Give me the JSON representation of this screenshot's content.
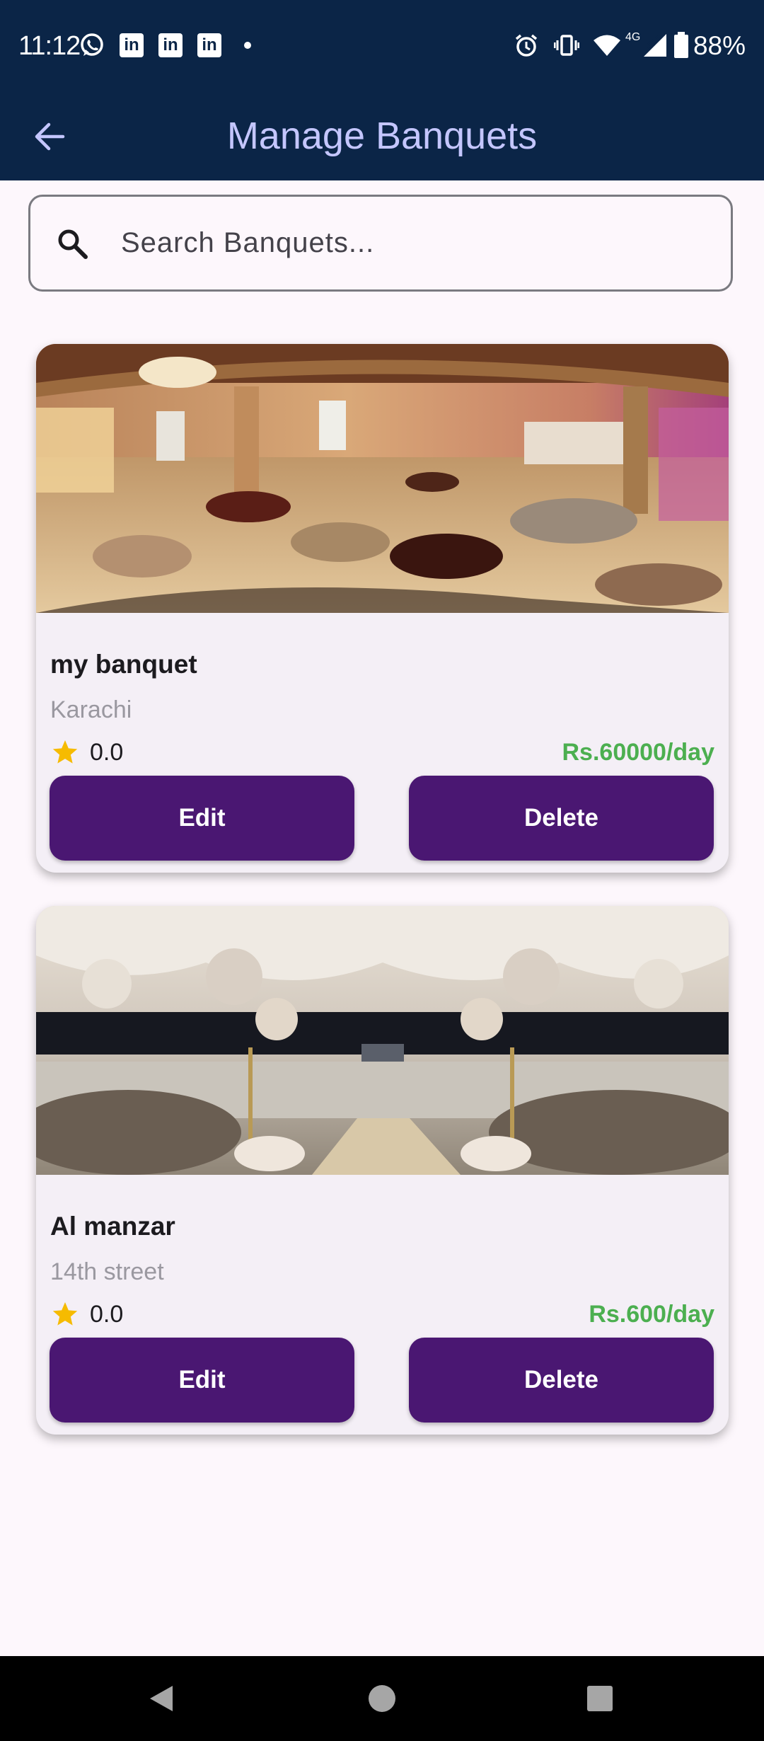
{
  "status_bar": {
    "time": "11:12",
    "battery": "88%",
    "network_label": "4G",
    "icons": [
      "whatsapp-icon",
      "linkedin-icon",
      "linkedin-icon",
      "linkedin-icon",
      "alarm-icon",
      "vibrate-icon",
      "wifi-icon",
      "signal-icon",
      "battery-icon"
    ],
    "linkedin_letters": "in"
  },
  "app_bar": {
    "title": "Manage Banquets",
    "back_icon": "arrow-left-icon",
    "title_color": "#c4c6ff",
    "background": "#0b2547"
  },
  "search": {
    "placeholder": "Search Banquets...",
    "value": "",
    "icon": "search-icon"
  },
  "banquets": [
    {
      "name": "my banquet",
      "location": "Karachi",
      "rating": "0.0",
      "price": "Rs.60000/day",
      "edit_label": "Edit",
      "delete_label": "Delete"
    },
    {
      "name": "Al manzar",
      "location": "14th street",
      "rating": "0.0",
      "price": "Rs.600/day",
      "edit_label": "Edit",
      "delete_label": "Delete"
    }
  ],
  "colors": {
    "button": "#4a1772",
    "price": "#4caf50",
    "star": "#f6bb00",
    "card": "#f4eff6",
    "page": "#fdf7fc"
  },
  "nav_bar": {
    "icons": [
      "back-triangle-icon",
      "home-circle-icon",
      "recents-square-icon"
    ]
  }
}
